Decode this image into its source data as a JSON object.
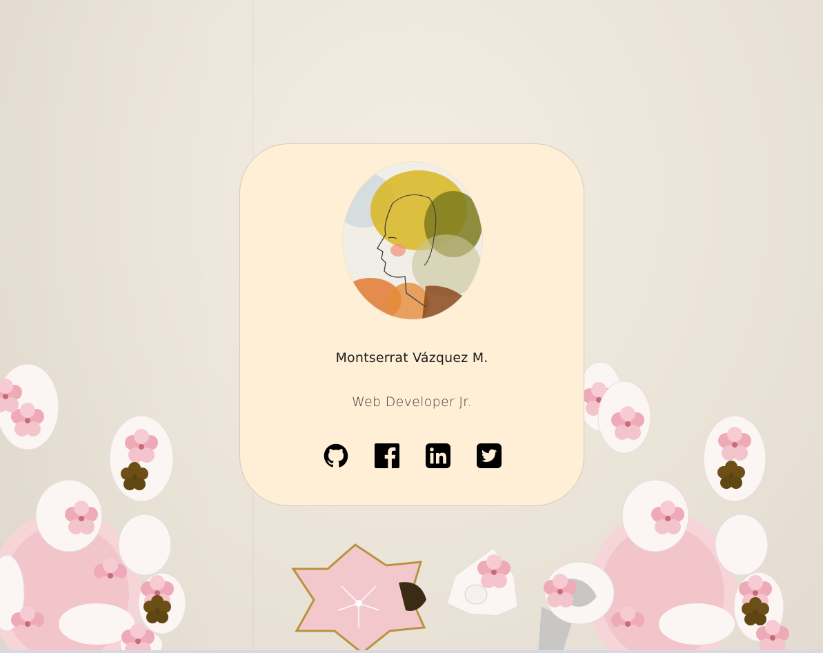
{
  "profile": {
    "name": "Montserrat Vázquez M.",
    "role": "Web Developer Jr."
  },
  "social_links": [
    {
      "icon": "github-icon"
    },
    {
      "icon": "facebook-icon"
    },
    {
      "icon": "linkedin-icon"
    },
    {
      "icon": "twitter-icon"
    }
  ],
  "colors": {
    "card_background": "#ffefd6",
    "page_background": "#ece5da",
    "icon_color": "#000000"
  }
}
